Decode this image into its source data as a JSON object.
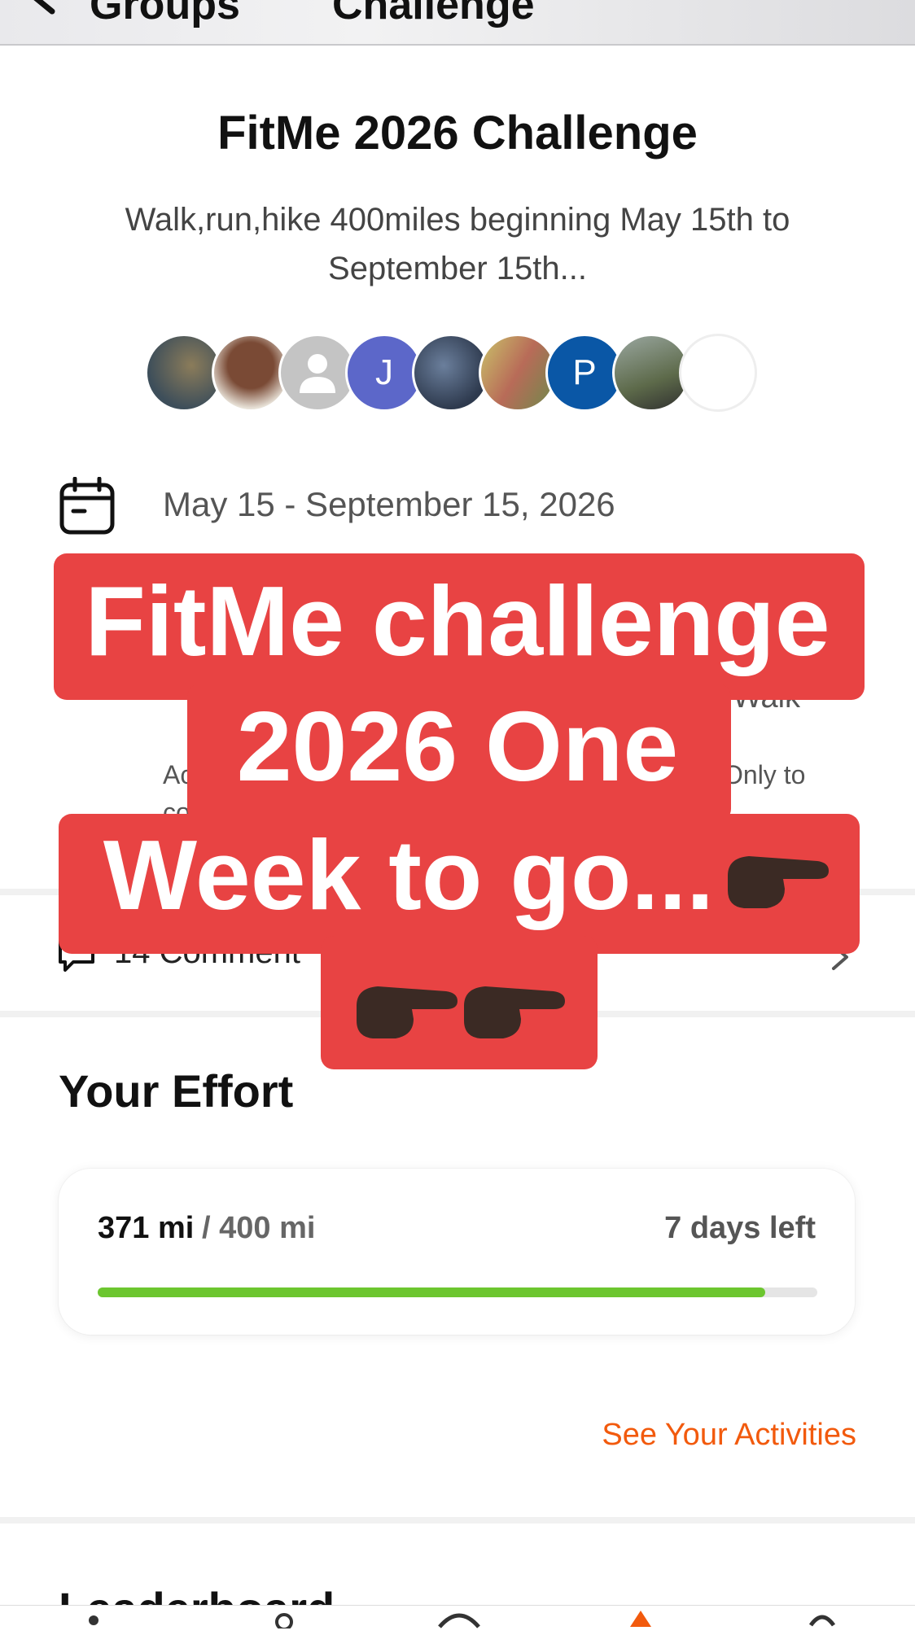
{
  "nav": {
    "back_label": "Groups",
    "title": "Challenge"
  },
  "challenge": {
    "title": "FitMe 2026 Challenge",
    "description_line1": "Walk,run,hike  400miles beginning May 15th to",
    "description_line2": "September 15th...",
    "date_range": "May 15 - September 15, 2026"
  },
  "avatars": [
    {
      "kind": "photo",
      "color": "#3d4e5a"
    },
    {
      "kind": "photo",
      "color": "#7a4a35"
    },
    {
      "kind": "placeholder",
      "color": "#c4c4c4"
    },
    {
      "kind": "initial",
      "initial": "J",
      "color": "#5c67c9"
    },
    {
      "kind": "photo",
      "color": "#2e3a4e"
    },
    {
      "kind": "photo",
      "color": "#b86b58"
    },
    {
      "kind": "initial",
      "initial": "P",
      "color": "#0a57a6"
    },
    {
      "kind": "photo",
      "color": "#5d6a4a"
    },
    {
      "kind": "blank",
      "color": "#ffffff"
    }
  ],
  "partial": {
    "line_a_right": "Walk",
    "line_b_left": "Ac",
    "line_b_right": "Only to",
    "line_c_left": "co"
  },
  "comments": {
    "label": "14 Comment"
  },
  "effort": {
    "title": "Your Effort",
    "current": "371 mi",
    "goal": "/ 400 mi",
    "days_left": "7 days left",
    "progress_fraction": 0.9275,
    "bar_color": "#6cc62f",
    "see_activities": "See Your Activities"
  },
  "leaderboard": {
    "title": "Leaderboard"
  },
  "overlay": {
    "line1": "FitMe challenge",
    "line2": "2026 One",
    "line3": "Week to go...",
    "color": "#e84343"
  },
  "colors": {
    "accent": "#f25a0d"
  }
}
